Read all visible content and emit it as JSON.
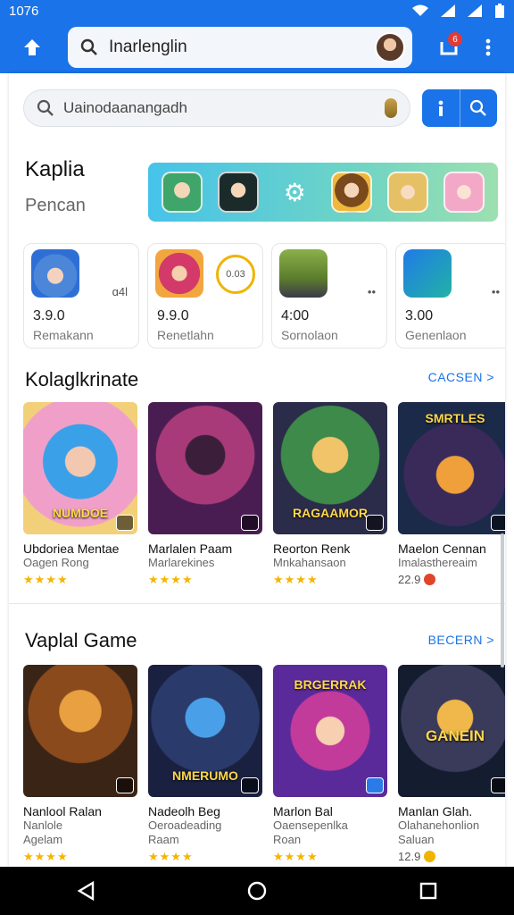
{
  "status": {
    "time": "1076"
  },
  "top_search": {
    "text": "Inarlenglin",
    "notification_count": "6"
  },
  "inner_search": {
    "text": "Uainodaanangadh"
  },
  "header": {
    "title": "Kaplia",
    "subtitle": "Pencan"
  },
  "featured_cards": [
    {
      "rating": "3.9.0",
      "label": "Remakann",
      "side": "ɑ4l"
    },
    {
      "rating": "9.9.0",
      "label": "Renetlahn",
      "side": "0.03"
    },
    {
      "rating": "4:00",
      "label": "Sornolaon",
      "side": "••"
    },
    {
      "rating": "3.00",
      "label": "Genenlaon",
      "side": "••"
    }
  ],
  "section1": {
    "title": "Kolaglkrinate",
    "see_all": "CACSEN >",
    "games": [
      {
        "name": "Ubdoriea Mentae",
        "dev": "Oagen Rong",
        "stars": "★★★★",
        "art_title": "NUMDOE"
      },
      {
        "name": "Marlalen Paam",
        "dev": "Marlarekines",
        "stars": "★★★★",
        "art_title": ""
      },
      {
        "name": "Reorton Renk",
        "dev": "Mnkahansaon",
        "stars": "★★★★",
        "art_title": "RAGAAMOR"
      },
      {
        "name": "Maelon Cennan",
        "dev": "Imalasthereaim",
        "score": "22.9",
        "art_title": "SMRTLES"
      }
    ]
  },
  "section2": {
    "title": "Vaplal Game",
    "see_all": "BECERN >",
    "games": [
      {
        "name": "Nanlool Ralan",
        "dev": "Nanlole",
        "dev2": "Agelam",
        "stars": "★★★★",
        "art_title": ""
      },
      {
        "name": "Nadeolh Beg",
        "dev": "Oeroadeading",
        "dev2": "Raam",
        "stars": "★★★★",
        "art_title": "NMERUMO"
      },
      {
        "name": "Marlon Bal",
        "dev": "Oaensepenlka",
        "dev2": "Roan",
        "stars": "★★★★",
        "art_title": "BRGERRAK"
      },
      {
        "name": "Manlan Glah.",
        "dev": "Olahanehonlion",
        "dev2": "Saluan",
        "score": "12.9",
        "art_title": "GANEIN"
      }
    ]
  },
  "colors": {
    "accent": "#1a73e8",
    "star": "#f5b400"
  }
}
